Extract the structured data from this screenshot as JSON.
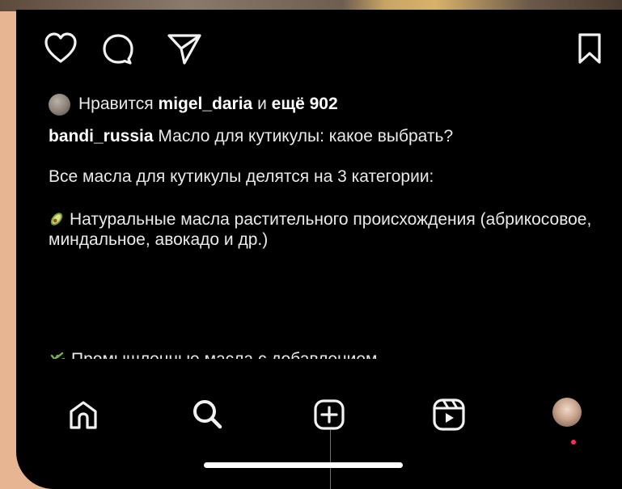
{
  "actions": {
    "like_icon": "heart-icon",
    "comment_icon": "comment-icon",
    "share_icon": "send-icon",
    "save_icon": "bookmark-icon"
  },
  "likes": {
    "prefix": "Нравится",
    "user": "migel_daria",
    "connector": "и",
    "count": "ещё 902"
  },
  "post": {
    "author": "bandi_russia",
    "title": "Масло для кутикулы: какое выбрать?",
    "line2": "Все масла для кутикулы делятся на 3 категории:",
    "item1": "Натуральные масла растительного происхождения (абрикосовое, миндальное, авокадо и др.)",
    "item1_emoji": "🥑",
    "item2": "Промышленные масла с добавлением",
    "item2_emoji": "🌿"
  },
  "bottom_nav": {
    "items": [
      "home-icon",
      "search-icon",
      "create-post-icon",
      "reels-icon",
      "profile-avatar"
    ]
  },
  "colors": {
    "background_page": "#e8b592",
    "app_background": "#000000",
    "text": "#eaeaea",
    "notification_dot": "#ff2d55"
  }
}
